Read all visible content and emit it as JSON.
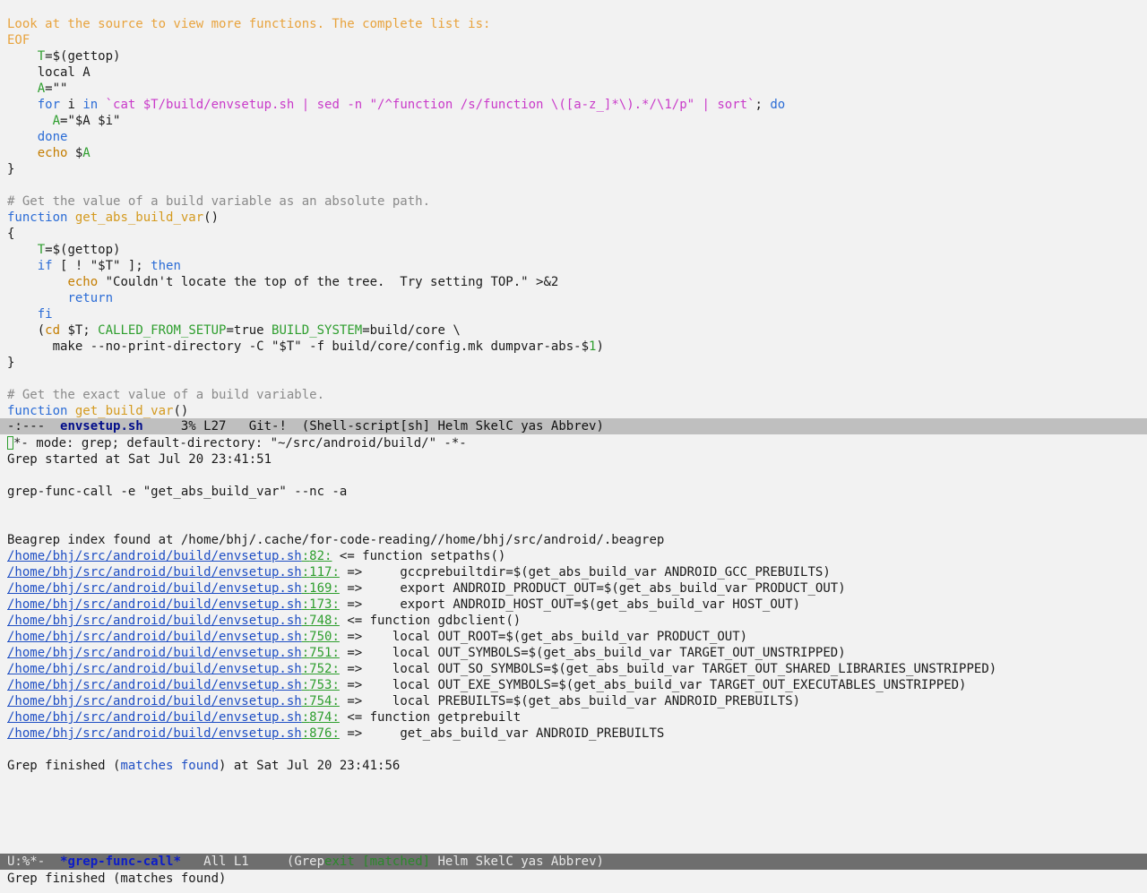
{
  "code_pane": {
    "lines": [
      [
        {
          "t": "Look at the source to view more functions. The complete list is:",
          "c": "str-doc"
        }
      ],
      [
        {
          "t": "EOF",
          "c": "str-doc"
        }
      ],
      [
        {
          "t": "    ",
          "c": ""
        },
        {
          "t": "T",
          "c": "var"
        },
        {
          "t": "=$(gettop)",
          "c": ""
        }
      ],
      [
        {
          "t": "    local A",
          "c": ""
        }
      ],
      [
        {
          "t": "    ",
          "c": ""
        },
        {
          "t": "A",
          "c": "var"
        },
        {
          "t": "=\"\"",
          "c": ""
        }
      ],
      [
        {
          "t": "    ",
          "c": ""
        },
        {
          "t": "for",
          "c": "kw"
        },
        {
          "t": " i ",
          "c": ""
        },
        {
          "t": "in",
          "c": "kw"
        },
        {
          "t": " ",
          "c": ""
        },
        {
          "t": "`cat $T/build/envsetup.sh | sed -n \"/^function /s/function \\([a-z_]*\\).*/\\1/p\" | sort`",
          "c": "str"
        },
        {
          "t": "; ",
          "c": ""
        },
        {
          "t": "do",
          "c": "kw"
        }
      ],
      [
        {
          "t": "      ",
          "c": ""
        },
        {
          "t": "A",
          "c": "var"
        },
        {
          "t": "=\"$A $i\"",
          "c": ""
        }
      ],
      [
        {
          "t": "    ",
          "c": ""
        },
        {
          "t": "done",
          "c": "kw"
        }
      ],
      [
        {
          "t": "    ",
          "c": ""
        },
        {
          "t": "echo",
          "c": "builtin"
        },
        {
          "t": " $",
          "c": ""
        },
        {
          "t": "A",
          "c": "var"
        }
      ],
      [
        {
          "t": "}",
          "c": ""
        }
      ],
      [
        {
          "t": "",
          "c": ""
        }
      ],
      [
        {
          "t": "# Get the value of a build variable as an absolute path.",
          "c": "comment"
        }
      ],
      [
        {
          "t": "function",
          "c": "kw"
        },
        {
          "t": " ",
          "c": ""
        },
        {
          "t": "get_abs_build_var",
          "c": "fn"
        },
        {
          "t": "()",
          "c": ""
        }
      ],
      [
        {
          "t": "{",
          "c": ""
        }
      ],
      [
        {
          "t": "    ",
          "c": ""
        },
        {
          "t": "T",
          "c": "var"
        },
        {
          "t": "=$(gettop)",
          "c": ""
        }
      ],
      [
        {
          "t": "    ",
          "c": ""
        },
        {
          "t": "if",
          "c": "kw"
        },
        {
          "t": " [ ! \"$T\" ]; ",
          "c": ""
        },
        {
          "t": "then",
          "c": "kw"
        }
      ],
      [
        {
          "t": "        ",
          "c": ""
        },
        {
          "t": "echo",
          "c": "builtin"
        },
        {
          "t": " \"Couldn't locate the top of the tree.  Try setting TOP.\" >&2",
          "c": ""
        }
      ],
      [
        {
          "t": "        ",
          "c": ""
        },
        {
          "t": "return",
          "c": "kw"
        }
      ],
      [
        {
          "t": "    ",
          "c": ""
        },
        {
          "t": "fi",
          "c": "kw"
        }
      ],
      [
        {
          "t": "    (",
          "c": ""
        },
        {
          "t": "cd",
          "c": "builtin"
        },
        {
          "t": " $T; ",
          "c": ""
        },
        {
          "t": "CALLED_FROM_SETUP",
          "c": "var"
        },
        {
          "t": "=true ",
          "c": ""
        },
        {
          "t": "BUILD_SYSTEM",
          "c": "var"
        },
        {
          "t": "=build/core \\",
          "c": ""
        }
      ],
      [
        {
          "t": "      make --no-print-directory -C \"$T\" -f build/core/config.mk dumpvar-abs-$",
          "c": ""
        },
        {
          "t": "1",
          "c": "var"
        },
        {
          "t": ")",
          "c": ""
        }
      ],
      [
        {
          "t": "}",
          "c": ""
        }
      ],
      [
        {
          "t": "",
          "c": ""
        }
      ],
      [
        {
          "t": "# Get the exact value of a build variable.",
          "c": "comment"
        }
      ],
      [
        {
          "t": "function",
          "c": "kw"
        },
        {
          "t": " ",
          "c": ""
        },
        {
          "t": "get_build_var",
          "c": "fn"
        },
        {
          "t": "()",
          "c": ""
        }
      ]
    ]
  },
  "modeline_top": {
    "prefix": "-:---  ",
    "buffer": "envsetup.sh",
    "position": "     3% L27   ",
    "vcs": "Git-!",
    "modes": "  (Shell-script[sh] Helm SkelC yas Abbrev)"
  },
  "grep_pane": {
    "header": "*- mode: grep; default-directory: \"~/src/android/build/\" -*-",
    "started": "Grep started at Sat Jul 20 23:41:51",
    "command": "grep-func-call -e \"get_abs_build_var\" --nc -a",
    "index_note": "Beagrep index found at /home/bhj/.cache/for-code-reading//home/bhj/src/android/.beagrep",
    "results": [
      {
        "file": "/home/bhj/src/android/build/envsetup.sh",
        "line": "82",
        "text": " <= function setpaths()"
      },
      {
        "file": "/home/bhj/src/android/build/envsetup.sh",
        "line": "117",
        "text": " =>     gccprebuiltdir=$(get_abs_build_var ANDROID_GCC_PREBUILTS)"
      },
      {
        "file": "/home/bhj/src/android/build/envsetup.sh",
        "line": "169",
        "text": " =>     export ANDROID_PRODUCT_OUT=$(get_abs_build_var PRODUCT_OUT)"
      },
      {
        "file": "/home/bhj/src/android/build/envsetup.sh",
        "line": "173",
        "text": " =>     export ANDROID_HOST_OUT=$(get_abs_build_var HOST_OUT)"
      },
      {
        "file": "/home/bhj/src/android/build/envsetup.sh",
        "line": "748",
        "text": " <= function gdbclient()"
      },
      {
        "file": "/home/bhj/src/android/build/envsetup.sh",
        "line": "750",
        "text": " =>    local OUT_ROOT=$(get_abs_build_var PRODUCT_OUT)"
      },
      {
        "file": "/home/bhj/src/android/build/envsetup.sh",
        "line": "751",
        "text": " =>    local OUT_SYMBOLS=$(get_abs_build_var TARGET_OUT_UNSTRIPPED)"
      },
      {
        "file": "/home/bhj/src/android/build/envsetup.sh",
        "line": "752",
        "text": " =>    local OUT_SO_SYMBOLS=$(get_abs_build_var TARGET_OUT_SHARED_LIBRARIES_UNSTRIPPED)"
      },
      {
        "file": "/home/bhj/src/android/build/envsetup.sh",
        "line": "753",
        "text": " =>    local OUT_EXE_SYMBOLS=$(get_abs_build_var TARGET_OUT_EXECUTABLES_UNSTRIPPED)"
      },
      {
        "file": "/home/bhj/src/android/build/envsetup.sh",
        "line": "754",
        "text": " =>    local PREBUILTS=$(get_abs_build_var ANDROID_PREBUILTS)"
      },
      {
        "file": "/home/bhj/src/android/build/envsetup.sh",
        "line": "874",
        "text": " <= function getprebuilt"
      },
      {
        "file": "/home/bhj/src/android/build/envsetup.sh",
        "line": "876",
        "text": " =>     get_abs_build_var ANDROID_PREBUILTS"
      }
    ],
    "finished_prefix": "Grep finished (",
    "finished_matches": "matches found",
    "finished_suffix": ") at Sat Jul 20 23:41:56"
  },
  "modeline_bottom": {
    "prefix": "U:%*-  ",
    "buffer": "*grep-func-call*",
    "position": "   All L1     ",
    "modes_open": "(Grep",
    "status": "exit [matched]",
    "modes_rest": " Helm SkelC yas Abbrev)"
  },
  "echo_area": "Grep finished (matches found)"
}
